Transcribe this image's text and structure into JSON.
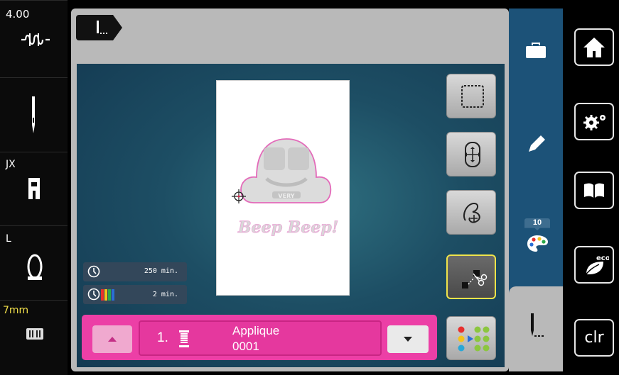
{
  "left_panel": {
    "stitch_length": "4.00",
    "presser_foot": "JX",
    "needle_plate_label": "L",
    "stitch_width": "7mm"
  },
  "info_panel": {
    "total_time": "250 min.",
    "color_time": "2 min."
  },
  "design": {
    "text": "Beep Beep!",
    "badge": "VERY"
  },
  "color_bar": {
    "index": "1.",
    "name": "Applique",
    "code": "0001"
  },
  "right_panel": {
    "color_count": "10"
  },
  "system": {
    "clr_label": "clr"
  },
  "colors": {
    "pink_bar": "#ec3fa6",
    "active_border": "#f0e44a",
    "right_panel": "#1c5278"
  }
}
